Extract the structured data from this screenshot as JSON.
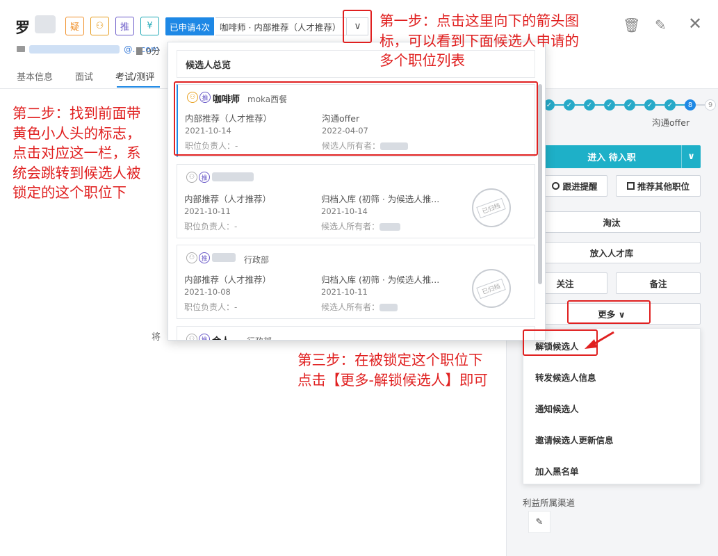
{
  "candidate": {
    "name": "罗",
    "email_tail": "@...com",
    "score": "0分"
  },
  "tags": {
    "doubt": "疑",
    "person": "⚇",
    "recommend": "推",
    "yen": "¥"
  },
  "application": {
    "applied_count": "已申请4次",
    "job_selected": "咖啡师 · 内部推荐（人才推荐）",
    "chevron": "∨"
  },
  "tabs": [
    "基本信息",
    "面试",
    "考试/测评"
  ],
  "header_icons": {
    "trash": "🗑",
    "edit": "✎",
    "close": "✕"
  },
  "left_text": "将",
  "dropdown": {
    "title": "候选人总览",
    "cards": [
      {
        "title": "咖啡师",
        "sub": "moka西餐",
        "left_line": "内部推荐（人才推荐）",
        "left_date": "2021-10-14",
        "left_meta": "职位负责人：-",
        "right_line": "沟通offer",
        "right_date": "2022-04-07",
        "right_meta": "候选人所有者：",
        "stamp": ""
      },
      {
        "title": "",
        "sub": "",
        "left_line": "内部推荐（人才推荐）",
        "left_date": "2021-10-11",
        "left_meta": "职位负责人：-",
        "right_line": "归档入库 (初筛 · 为候选人推...",
        "right_date": "2021-10-14",
        "right_meta": "候选人所有者：",
        "stamp": "已归档"
      },
      {
        "title": "",
        "sub": "行政部",
        "left_line": "内部推荐（人才推荐）",
        "left_date": "2021-10-08",
        "left_meta": "职位负责人：-",
        "right_line": "归档入库 (初筛 · 为候选人推...",
        "right_date": "2021-10-11",
        "right_meta": "候选人所有者：",
        "stamp": "已归档"
      },
      {
        "title": "合人",
        "sub": "行政部"
      }
    ]
  },
  "pipeline": {
    "steps": [
      "✓",
      "✓",
      "✓",
      "✓",
      "✓",
      "✓",
      "✓",
      "8",
      "9"
    ],
    "current_stage": "沟通offer"
  },
  "actions": {
    "primary": "进入 待入职",
    "primary_arrow": "∨",
    "follow_up": "跟进提醒",
    "recommend_other": "推荐其他职位",
    "reject": "淘汰",
    "talent_pool": "放入人才库",
    "watch": "关注",
    "note": "备注",
    "more": "更多 ∨"
  },
  "more_menu": [
    "解锁候选人",
    "转发候选人信息",
    "通知候选人",
    "邀请候选人更新信息",
    "加入黑名单"
  ],
  "channel": {
    "label": "利益所属渠道",
    "edit_icon": "✎"
  },
  "annotations": {
    "step1": "第一步：点击这里向下的箭头图标，可以看到下面候选人申请的多个职位列表",
    "step1_lines": [
      "第一步：点击这里向下的箭头图",
      "标，可以看到下面候选人申请的",
      "多个职位列表"
    ],
    "step2": "第二步：找到前面带黄色小人头的标志，点击对应这一栏，系统会跳转到候选人被锁定的这个职位下",
    "step2_lines": [
      "第二步：找到前面带",
      "黄色小人头的标志，",
      "点击对应这一栏，系",
      "统会跳转到候选人被",
      "锁定的这个职位下"
    ],
    "step3": "第三步：在被锁定这个职位下点击【更多-解锁候选人】即可",
    "step3_lines": [
      "第三步：在被锁定这个职位下",
      "点击【更多-解锁候选人】即可"
    ],
    "color": "#e02020"
  }
}
